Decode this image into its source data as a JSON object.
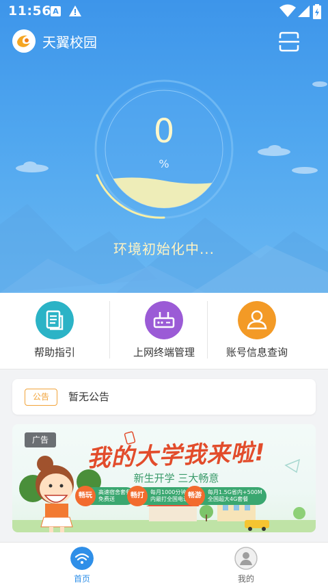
{
  "status_bar": {
    "time": "11:56",
    "a_badge": "A"
  },
  "header": {
    "app_title": "天翼校园"
  },
  "gauge": {
    "value": "0",
    "unit": "%",
    "fill_fraction": 0.25
  },
  "init_status": "环境初始化中...",
  "actions": [
    {
      "label": "帮助指引",
      "icon": "document-icon",
      "color": "#2bb3c6"
    },
    {
      "label": "上网终端管理",
      "icon": "router-icon",
      "color": "#9b5bd6"
    },
    {
      "label": "账号信息查询",
      "icon": "user-icon",
      "color": "#f39a26"
    }
  ],
  "notice": {
    "badge": "公告",
    "text": "暂无公告"
  },
  "banner": {
    "ad_tag": "广告",
    "title": "我的大学我来啦!",
    "subtitle": "新生开学 三大畅意",
    "pills": [
      {
        "tag": "畅玩",
        "line1": "高速宿舍套餐",
        "line2": "免费送"
      },
      {
        "tag": "畅打",
        "line1": "每月1000分钟校",
        "line2": "内最打全国电话"
      },
      {
        "tag": "畅游",
        "line1": "每月1.5G省内+500M",
        "line2": "全国超大4G套餐"
      }
    ]
  },
  "tabbar": {
    "home": {
      "label": "首页",
      "active": true
    },
    "mine": {
      "label": "我的",
      "active": false
    }
  },
  "colors": {
    "primary": "#3d95ea",
    "accent_text": "#fff3c2",
    "tab_active": "#2f8fe8",
    "tab_inactive": "#666666"
  }
}
